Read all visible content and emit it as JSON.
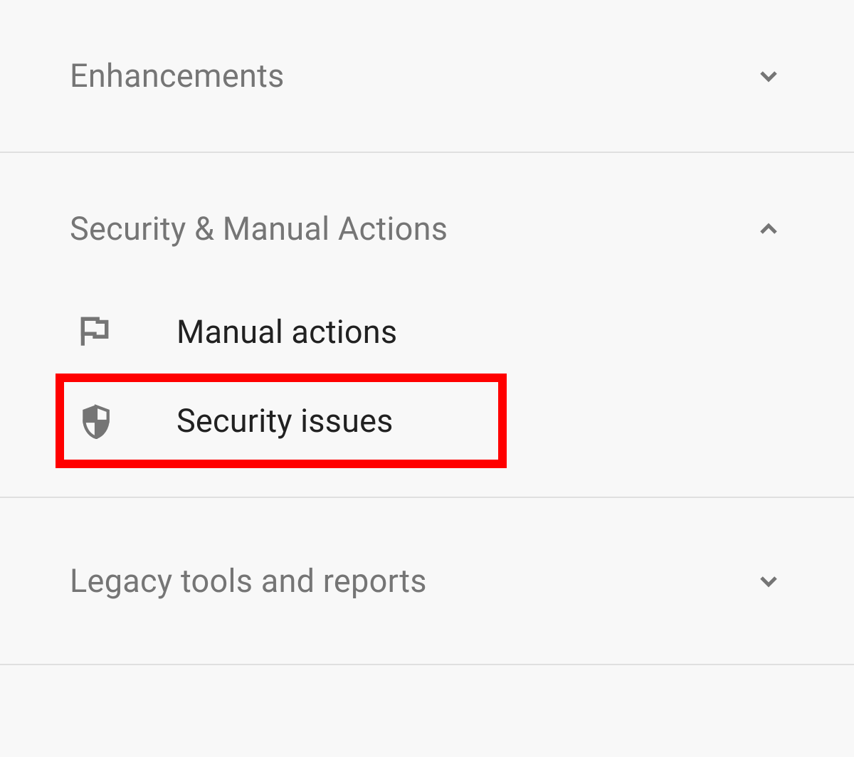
{
  "sections": [
    {
      "title": "Enhancements",
      "expanded": false
    },
    {
      "title": "Security & Manual Actions",
      "expanded": true,
      "items": [
        {
          "label": "Manual actions",
          "icon": "flag-icon",
          "highlighted": false
        },
        {
          "label": "Security issues",
          "icon": "shield-icon",
          "highlighted": true
        }
      ]
    },
    {
      "title": "Legacy tools and reports",
      "expanded": false
    }
  ],
  "colors": {
    "highlight_border": "#ff0000",
    "section_title": "#757575",
    "item_label": "#212121",
    "icon_color": "#757575"
  }
}
